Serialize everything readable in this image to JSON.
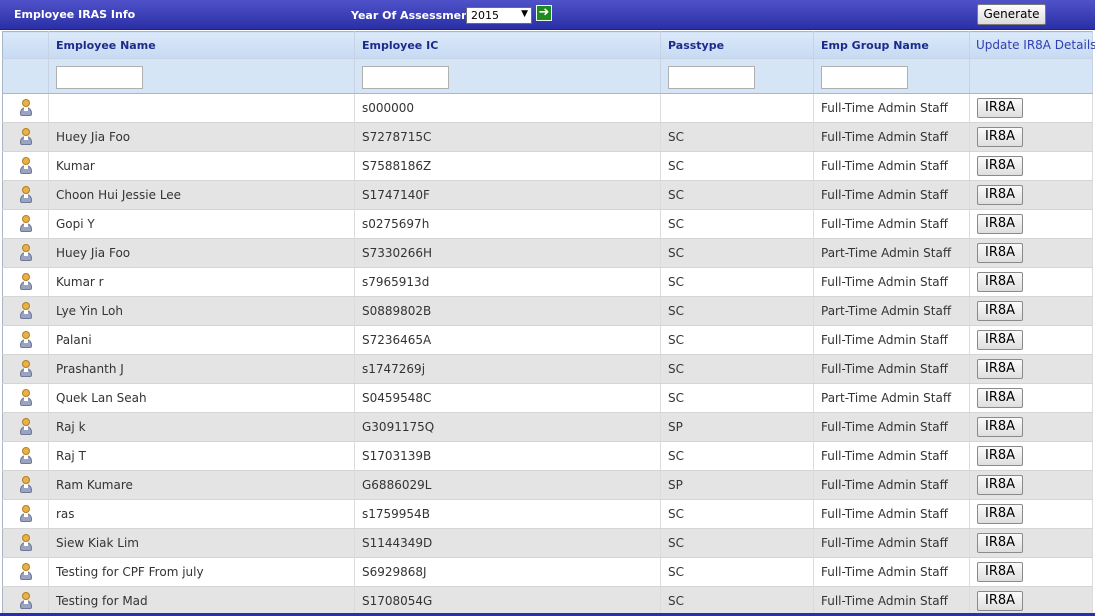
{
  "header": {
    "title": "Employee IRAS Info",
    "year_label": "Year Of Assessment",
    "year_value": "2015",
    "go_icon": "green-right-arrow-icon",
    "generate_label": "Generate"
  },
  "grid": {
    "columns": [
      "Employee Name",
      "Employee IC",
      "Passtype",
      "Emp Group Name",
      "Update IR8A Details"
    ],
    "filter_values": [
      "",
      "",
      "",
      ""
    ],
    "row_icon": "person-icon",
    "button_label": "IR8A",
    "rows": [
      {
        "name": "",
        "ic": "s000000",
        "pass": "",
        "group": "Full-Time Admin Staff"
      },
      {
        "name": "Huey Jia Foo",
        "ic": "S7278715C",
        "pass": "SC",
        "group": "Full-Time Admin Staff"
      },
      {
        "name": "Kumar",
        "ic": "S7588186Z",
        "pass": "SC",
        "group": "Full-Time Admin Staff"
      },
      {
        "name": "Choon Hui Jessie Lee",
        "ic": "S1747140F",
        "pass": "SC",
        "group": "Full-Time Admin Staff"
      },
      {
        "name": "Gopi Y",
        "ic": "s0275697h",
        "pass": "SC",
        "group": "Full-Time Admin Staff"
      },
      {
        "name": "Huey Jia Foo",
        "ic": "S7330266H",
        "pass": "SC",
        "group": "Part-Time Admin Staff"
      },
      {
        "name": "Kumar r",
        "ic": "s7965913d",
        "pass": "SC",
        "group": "Full-Time Admin Staff"
      },
      {
        "name": "Lye Yin Loh",
        "ic": "S0889802B",
        "pass": "SC",
        "group": "Part-Time Admin Staff"
      },
      {
        "name": "Palani",
        "ic": "S7236465A",
        "pass": "SC",
        "group": "Full-Time Admin Staff"
      },
      {
        "name": "Prashanth J",
        "ic": "s1747269j",
        "pass": "SC",
        "group": "Full-Time Admin Staff"
      },
      {
        "name": "Quek Lan Seah",
        "ic": "S0459548C",
        "pass": "SC",
        "group": "Part-Time Admin Staff"
      },
      {
        "name": "Raj k",
        "ic": "G3091175Q",
        "pass": "SP",
        "group": "Full-Time Admin Staff"
      },
      {
        "name": "Raj T",
        "ic": "S1703139B",
        "pass": "SC",
        "group": "Full-Time Admin Staff"
      },
      {
        "name": "Ram Kumare",
        "ic": "G6886029L",
        "pass": "SP",
        "group": "Full-Time Admin Staff"
      },
      {
        "name": "ras",
        "ic": "s1759954B",
        "pass": "SC",
        "group": "Full-Time Admin Staff"
      },
      {
        "name": "Siew Kiak Lim",
        "ic": "S1144349D",
        "pass": "SC",
        "group": "Full-Time Admin Staff"
      },
      {
        "name": "Testing for CPF From july",
        "ic": "S6929868J",
        "pass": "SC",
        "group": "Full-Time Admin Staff"
      },
      {
        "name": "Testing for Mad",
        "ic": "S1708054G",
        "pass": "SC",
        "group": "Full-Time Admin Staff"
      }
    ]
  },
  "colors": {
    "header_bar": "#2b2fa6",
    "column_header_text": "#1c2b8a",
    "alt_row": "#e4e4e4",
    "filter_row": "#d6e5f6"
  }
}
